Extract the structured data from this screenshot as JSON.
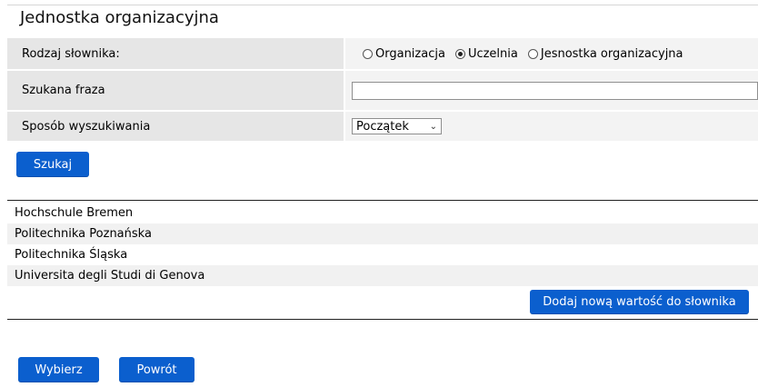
{
  "page": {
    "title": "Jednostka organizacyjna"
  },
  "form": {
    "type_label": "Rodzaj słownika:",
    "type_options": [
      {
        "label": "Organizacja",
        "checked": false
      },
      {
        "label": "Uczelnia",
        "checked": true
      },
      {
        "label": "Jesnostka organizacyjna",
        "checked": false
      }
    ],
    "phrase_label": "Szukana fraza",
    "phrase_value": "",
    "method_label": "Sposób wyszukiwania",
    "method_selected": "Początek",
    "search_button": "Szukaj"
  },
  "results": [
    "Hochschule Bremen",
    "Politechnika Poznańska",
    "Politechnika Śląska",
    "Universita degli Studi di Genova"
  ],
  "actions": {
    "add_button": "Dodaj nową wartość do słownika",
    "select_button": "Wybierz",
    "back_button": "Powrót"
  },
  "colors": {
    "button": "#0b5fce",
    "label_bg": "#e6e6e6",
    "value_bg": "#f3f3f3"
  }
}
